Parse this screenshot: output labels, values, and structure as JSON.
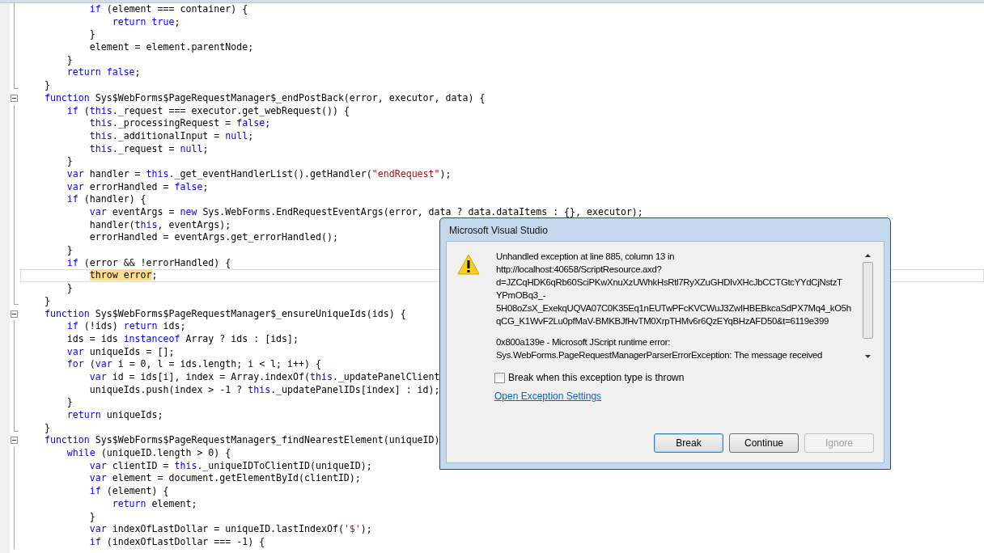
{
  "editor": {
    "lines": [
      {
        "collapsible": false,
        "block_end": false,
        "current": false,
        "parts": [
          {
            "kind": "kw",
            "text": "            if"
          },
          {
            "kind": "plain",
            "text": " (element === container) {"
          }
        ]
      },
      {
        "collapsible": false,
        "block_end": false,
        "current": false,
        "parts": [
          {
            "kind": "kw",
            "text": "                return true"
          },
          {
            "kind": "plain",
            "text": ";"
          }
        ]
      },
      {
        "collapsible": false,
        "block_end": false,
        "current": false,
        "parts": [
          {
            "kind": "plain",
            "text": "            }"
          }
        ]
      },
      {
        "collapsible": false,
        "block_end": false,
        "current": false,
        "parts": [
          {
            "kind": "plain",
            "text": "            element = element.parentNode;"
          }
        ]
      },
      {
        "collapsible": false,
        "block_end": false,
        "current": false,
        "parts": [
          {
            "kind": "plain",
            "text": "        }"
          }
        ]
      },
      {
        "collapsible": false,
        "block_end": false,
        "current": false,
        "parts": [
          {
            "kind": "kw",
            "text": "        return false"
          },
          {
            "kind": "plain",
            "text": ";"
          }
        ]
      },
      {
        "collapsible": false,
        "block_end": true,
        "current": false,
        "parts": [
          {
            "kind": "plain",
            "text": "    }"
          }
        ]
      },
      {
        "collapsible": true,
        "block_end": false,
        "current": false,
        "parts": [
          {
            "kind": "kw",
            "text": "    function"
          },
          {
            "kind": "plain",
            "text": " Sys$WebForms$PageRequestManager$_endPostBack(error, executor, data) {"
          }
        ]
      },
      {
        "collapsible": false,
        "block_end": false,
        "current": false,
        "parts": [
          {
            "kind": "kw",
            "text": "        if"
          },
          {
            "kind": "plain",
            "text": " ("
          },
          {
            "kind": "kw",
            "text": "this"
          },
          {
            "kind": "plain",
            "text": "._request === executor.get_webRequest()) {"
          }
        ]
      },
      {
        "collapsible": false,
        "block_end": false,
        "current": false,
        "parts": [
          {
            "kind": "kw",
            "text": "            this"
          },
          {
            "kind": "plain",
            "text": "._processingRequest = "
          },
          {
            "kind": "kw",
            "text": "false"
          },
          {
            "kind": "plain",
            "text": ";"
          }
        ]
      },
      {
        "collapsible": false,
        "block_end": false,
        "current": false,
        "parts": [
          {
            "kind": "kw",
            "text": "            this"
          },
          {
            "kind": "plain",
            "text": "._additionalInput = "
          },
          {
            "kind": "kw",
            "text": "null"
          },
          {
            "kind": "plain",
            "text": ";"
          }
        ]
      },
      {
        "collapsible": false,
        "block_end": false,
        "current": false,
        "parts": [
          {
            "kind": "kw",
            "text": "            this"
          },
          {
            "kind": "plain",
            "text": "._request = "
          },
          {
            "kind": "kw",
            "text": "null"
          },
          {
            "kind": "plain",
            "text": ";"
          }
        ]
      },
      {
        "collapsible": false,
        "block_end": false,
        "current": false,
        "parts": [
          {
            "kind": "plain",
            "text": "        }"
          }
        ]
      },
      {
        "collapsible": false,
        "block_end": false,
        "current": false,
        "parts": [
          {
            "kind": "kw",
            "text": "        var"
          },
          {
            "kind": "plain",
            "text": " handler = "
          },
          {
            "kind": "kw",
            "text": "this"
          },
          {
            "kind": "plain",
            "text": "._get_eventHandlerList().getHandler("
          },
          {
            "kind": "str",
            "text": "\"endRequest\""
          },
          {
            "kind": "plain",
            "text": ");"
          }
        ]
      },
      {
        "collapsible": false,
        "block_end": false,
        "current": false,
        "parts": [
          {
            "kind": "kw",
            "text": "        var"
          },
          {
            "kind": "plain",
            "text": " errorHandled = "
          },
          {
            "kind": "kw",
            "text": "false"
          },
          {
            "kind": "plain",
            "text": ";"
          }
        ]
      },
      {
        "collapsible": false,
        "block_end": false,
        "current": false,
        "parts": [
          {
            "kind": "kw",
            "text": "        if"
          },
          {
            "kind": "plain",
            "text": " (handler) {"
          }
        ]
      },
      {
        "collapsible": false,
        "block_end": false,
        "current": false,
        "parts": [
          {
            "kind": "kw",
            "text": "            var"
          },
          {
            "kind": "plain",
            "text": " eventArgs = "
          },
          {
            "kind": "kw",
            "text": "new"
          },
          {
            "kind": "plain",
            "text": " Sys.WebForms.EndRequestEventArgs(error, data ? data.dataItems : {}, executor);"
          }
        ]
      },
      {
        "collapsible": false,
        "block_end": false,
        "current": false,
        "parts": [
          {
            "kind": "plain",
            "text": "            handler("
          },
          {
            "kind": "kw",
            "text": "this"
          },
          {
            "kind": "plain",
            "text": ", eventArgs);"
          }
        ]
      },
      {
        "collapsible": false,
        "block_end": false,
        "current": false,
        "parts": [
          {
            "kind": "plain",
            "text": "            errorHandled = eventArgs.get_errorHandled();"
          }
        ]
      },
      {
        "collapsible": false,
        "block_end": false,
        "current": false,
        "parts": [
          {
            "kind": "plain",
            "text": "        }"
          }
        ]
      },
      {
        "collapsible": false,
        "block_end": false,
        "current": false,
        "parts": [
          {
            "kind": "kw",
            "text": "        if"
          },
          {
            "kind": "plain",
            "text": " (error && !errorHandled) {"
          }
        ]
      },
      {
        "collapsible": false,
        "block_end": false,
        "current": true,
        "parts": [
          {
            "kind": "hl",
            "text": "            throw error"
          },
          {
            "kind": "plain",
            "text": ";"
          }
        ]
      },
      {
        "collapsible": false,
        "block_end": false,
        "current": false,
        "parts": [
          {
            "kind": "plain",
            "text": "        }"
          }
        ]
      },
      {
        "collapsible": false,
        "block_end": true,
        "current": false,
        "parts": [
          {
            "kind": "plain",
            "text": "    }"
          }
        ]
      },
      {
        "collapsible": true,
        "block_end": false,
        "current": false,
        "parts": [
          {
            "kind": "kw",
            "text": "    function"
          },
          {
            "kind": "plain",
            "text": " Sys$WebForms$PageRequestManager$_ensureUniqueIds(ids) {"
          }
        ]
      },
      {
        "collapsible": false,
        "block_end": false,
        "current": false,
        "parts": [
          {
            "kind": "kw",
            "text": "        if"
          },
          {
            "kind": "plain",
            "text": " (!ids) "
          },
          {
            "kind": "kw",
            "text": "return"
          },
          {
            "kind": "plain",
            "text": " ids;"
          }
        ]
      },
      {
        "collapsible": false,
        "block_end": false,
        "current": false,
        "parts": [
          {
            "kind": "plain",
            "text": "        ids = ids "
          },
          {
            "kind": "kw",
            "text": "instanceof"
          },
          {
            "kind": "plain",
            "text": " Array ? ids : [ids];"
          }
        ]
      },
      {
        "collapsible": false,
        "block_end": false,
        "current": false,
        "parts": [
          {
            "kind": "kw",
            "text": "        var"
          },
          {
            "kind": "plain",
            "text": " uniqueIds = [];"
          }
        ]
      },
      {
        "collapsible": false,
        "block_end": false,
        "current": false,
        "parts": [
          {
            "kind": "kw",
            "text": "        for"
          },
          {
            "kind": "plain",
            "text": " ("
          },
          {
            "kind": "kw",
            "text": "var"
          },
          {
            "kind": "plain",
            "text": " i = 0, l = ids.length; i < l; i++) {"
          }
        ]
      },
      {
        "collapsible": false,
        "block_end": false,
        "current": false,
        "parts": [
          {
            "kind": "kw",
            "text": "            var"
          },
          {
            "kind": "plain",
            "text": " id = ids[i], index = Array.indexOf("
          },
          {
            "kind": "kw",
            "text": "this"
          },
          {
            "kind": "plain",
            "text": "._updatePanelClient"
          }
        ]
      },
      {
        "collapsible": false,
        "block_end": false,
        "current": false,
        "parts": [
          {
            "kind": "plain",
            "text": "            uniqueIds.push(index > -1 ? "
          },
          {
            "kind": "kw",
            "text": "this"
          },
          {
            "kind": "plain",
            "text": "._updatePanelIDs[index] : id);"
          }
        ]
      },
      {
        "collapsible": false,
        "block_end": false,
        "current": false,
        "parts": [
          {
            "kind": "plain",
            "text": "        }"
          }
        ]
      },
      {
        "collapsible": false,
        "block_end": false,
        "current": false,
        "parts": [
          {
            "kind": "kw",
            "text": "        return"
          },
          {
            "kind": "plain",
            "text": " uniqueIds;"
          }
        ]
      },
      {
        "collapsible": false,
        "block_end": true,
        "current": false,
        "parts": [
          {
            "kind": "plain",
            "text": "    }"
          }
        ]
      },
      {
        "collapsible": true,
        "block_end": false,
        "current": false,
        "parts": [
          {
            "kind": "kw",
            "text": "    function"
          },
          {
            "kind": "plain",
            "text": " Sys$WebForms$PageRequestManager$_findNearestElement(uniqueID)"
          }
        ]
      },
      {
        "collapsible": false,
        "block_end": false,
        "current": false,
        "parts": [
          {
            "kind": "kw",
            "text": "        while"
          },
          {
            "kind": "plain",
            "text": " (uniqueID.length > 0) {"
          }
        ]
      },
      {
        "collapsible": false,
        "block_end": false,
        "current": false,
        "parts": [
          {
            "kind": "kw",
            "text": "            var"
          },
          {
            "kind": "plain",
            "text": " clientID = "
          },
          {
            "kind": "kw",
            "text": "this"
          },
          {
            "kind": "plain",
            "text": "._uniqueIDToClientID(uniqueID);"
          }
        ]
      },
      {
        "collapsible": false,
        "block_end": false,
        "current": false,
        "parts": [
          {
            "kind": "kw",
            "text": "            var"
          },
          {
            "kind": "plain",
            "text": " element = document.getElementById(clientID);"
          }
        ]
      },
      {
        "collapsible": false,
        "block_end": false,
        "current": false,
        "parts": [
          {
            "kind": "kw",
            "text": "            if"
          },
          {
            "kind": "plain",
            "text": " (element) {"
          }
        ]
      },
      {
        "collapsible": false,
        "block_end": false,
        "current": false,
        "parts": [
          {
            "kind": "kw",
            "text": "                return"
          },
          {
            "kind": "plain",
            "text": " element;"
          }
        ]
      },
      {
        "collapsible": false,
        "block_end": false,
        "current": false,
        "parts": [
          {
            "kind": "plain",
            "text": "            }"
          }
        ]
      },
      {
        "collapsible": false,
        "block_end": false,
        "current": false,
        "parts": [
          {
            "kind": "kw",
            "text": "            var"
          },
          {
            "kind": "plain",
            "text": " indexOfLastDollar = uniqueID.lastIndexOf("
          },
          {
            "kind": "str",
            "text": "'$'"
          },
          {
            "kind": "plain",
            "text": ");"
          }
        ]
      },
      {
        "collapsible": false,
        "block_end": false,
        "current": false,
        "parts": [
          {
            "kind": "kw",
            "text": "            if"
          },
          {
            "kind": "plain",
            "text": " (indexOfLastDollar === -1) {"
          }
        ]
      }
    ]
  },
  "dialog": {
    "title": "Microsoft Visual Studio",
    "message_paragraphs": [
      {
        "lines": [
          "Unhandled exception at line 885, column 13 in",
          "http://localhost:40658/ScriptResource.axd?",
          "d=JZCqHDK6qRb60SciPKwXnuXzUWhkHsRtl7RyXZuGHDIvXHcJbCCTGtcYYdCjNstzT",
          "YPmOBq3_-",
          "5H08oZsX_ExekqUQVA07C0K35Eq1nEUTwPFcKVCWuJ3ZwIHBEBkcaSdPX7Mq4_kO5h",
          "qCG_K1WvF2Lu0pfMaV-BMKBJfHvTM0XrpTHMv6r6QzEYqBHzAFD50&t=6119e399"
        ]
      },
      {
        "lines": [
          "0x800a139e - Microsoft JScript runtime error:",
          "Sys.WebForms.PageRequestManagerParserErrorException: The message received"
        ]
      }
    ],
    "checkbox": {
      "label": "Break when this exception type is thrown",
      "checked": false
    },
    "link": "Open Exception Settings",
    "buttons": [
      {
        "label": "Break",
        "default": true,
        "disabled": false
      },
      {
        "label": "Continue",
        "default": false,
        "disabled": false
      },
      {
        "label": "Ignore",
        "default": false,
        "disabled": true
      }
    ]
  }
}
